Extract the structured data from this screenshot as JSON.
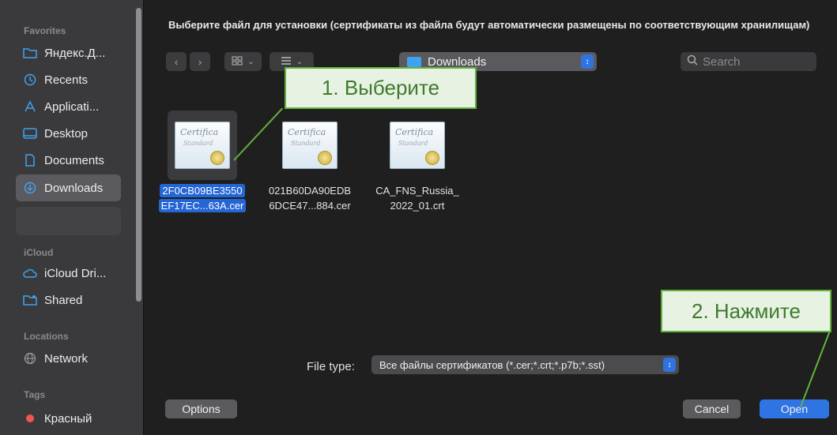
{
  "sidebar": {
    "favorites_label": "Favorites",
    "favorites": [
      {
        "label": "Яндекс.Д...",
        "icon": "folder-icon"
      },
      {
        "label": "Recents",
        "icon": "clock-icon"
      },
      {
        "label": "Applicati...",
        "icon": "applications-icon"
      },
      {
        "label": "Desktop",
        "icon": "desktop-icon"
      },
      {
        "label": "Documents",
        "icon": "document-icon"
      },
      {
        "label": "Downloads",
        "icon": "download-icon",
        "selected": true
      }
    ],
    "icloud_label": "iCloud",
    "icloud": [
      {
        "label": "iCloud Dri...",
        "icon": "cloud-icon"
      },
      {
        "label": "Shared",
        "icon": "shared-folder-icon"
      }
    ],
    "locations_label": "Locations",
    "locations": [
      {
        "label": "Network",
        "icon": "network-icon"
      }
    ],
    "tags_label": "Tags",
    "tags": [
      {
        "label": "Красный",
        "color": "#f0574f"
      }
    ]
  },
  "dialog": {
    "prompt": "Выберите файл для установки (сертификаты из файла будут автоматически размещены по соответствующим хранилищам)",
    "location": "Downloads",
    "search_placeholder": "Search",
    "files": [
      {
        "line1": "2F0CB09BE3550",
        "line2": "EF17EC...63A.cer",
        "selected": true
      },
      {
        "line1": "021B60DA90EDB",
        "line2": "6DCE47...884.cer",
        "selected": false
      },
      {
        "line1": "CA_FNS_Russia_",
        "line2": "2022_01.crt",
        "selected": false
      }
    ],
    "cert_title": "Certifica",
    "cert_subtitle": "Standard",
    "file_type_label": "File type:",
    "file_type_value": "Все файлы сертификатов (*.cer;*.crt;*.p7b;*.sst)",
    "options_label": "Options",
    "cancel_label": "Cancel",
    "open_label": "Open"
  },
  "annotations": {
    "step1": "1. Выберите",
    "step2": "2. Нажмите",
    "color": "#62b33c"
  }
}
